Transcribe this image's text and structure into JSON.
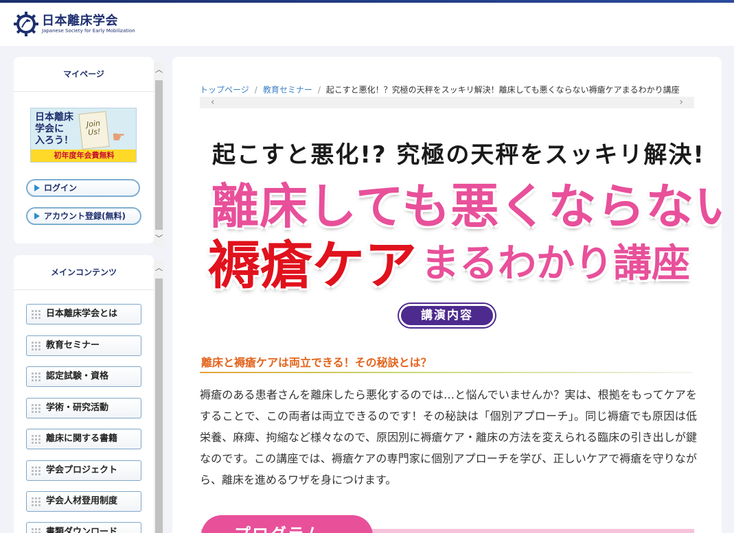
{
  "header": {
    "logo_jp": "日本離床学会",
    "logo_en": "Japanese Society for Early Mobilization"
  },
  "mypage": {
    "title": "マイページ",
    "banner": {
      "text": "日本離床\n学会に\n入ろう！",
      "card": "Join\nUs!",
      "strip": "初年度年会費無料"
    },
    "login_label": "ログイン",
    "register_label": "アカウント登録(無料)"
  },
  "maincontents": {
    "title": "メインコンテンツ",
    "items": [
      "日本離床学会とは",
      "教育セミナー",
      "認定試験・資格",
      "学術・研究活動",
      "離床に関する書籍",
      "学会プロジェクト",
      "学会人材登用制度",
      "書類ダウンロード"
    ]
  },
  "breadcrumb": {
    "home": "トップページ",
    "seminar": "教育セミナー",
    "current": "起こすと悪化！？究極の天秤をスッキリ解決！離床しても悪くならない褥瘡ケアまるわかり講座"
  },
  "hero": {
    "line1": "起こすと悪化!? 究極の天秤をスッキリ解決!",
    "line2": "離床しても悪くならない",
    "line3a": "褥瘡ケア",
    "line3b": "まるわかり講座"
  },
  "section": {
    "badge": "講演内容",
    "heading": "離床と褥瘡ケアは両立できる！その秘訣とは？",
    "body": "褥瘡のある患者さんを離床したら悪化するのでは…と悩んでいませんか？実は、根拠をもってケアをすることで、この両者は両立できるのです！その秘訣は「個別アプローチ」。同じ褥瘡でも原因は低栄養、麻痺、拘縮など様々なので、原因別に褥瘡ケア・離床の方法を変えられる臨床の引き出しが鍵なのです。この講座では、褥瘡ケアの専門家に個別アプローチを学び、正しいケアで褥瘡を守りながら、離床を進めるワザを身につけます。",
    "program": "プログラム"
  },
  "colors": {
    "brand": "#1e2f6e",
    "pink": "#e8509a",
    "red": "#e0121d",
    "purple": "#4d2a8e",
    "orange": "#e3651d",
    "link": "#3b7fc4"
  }
}
